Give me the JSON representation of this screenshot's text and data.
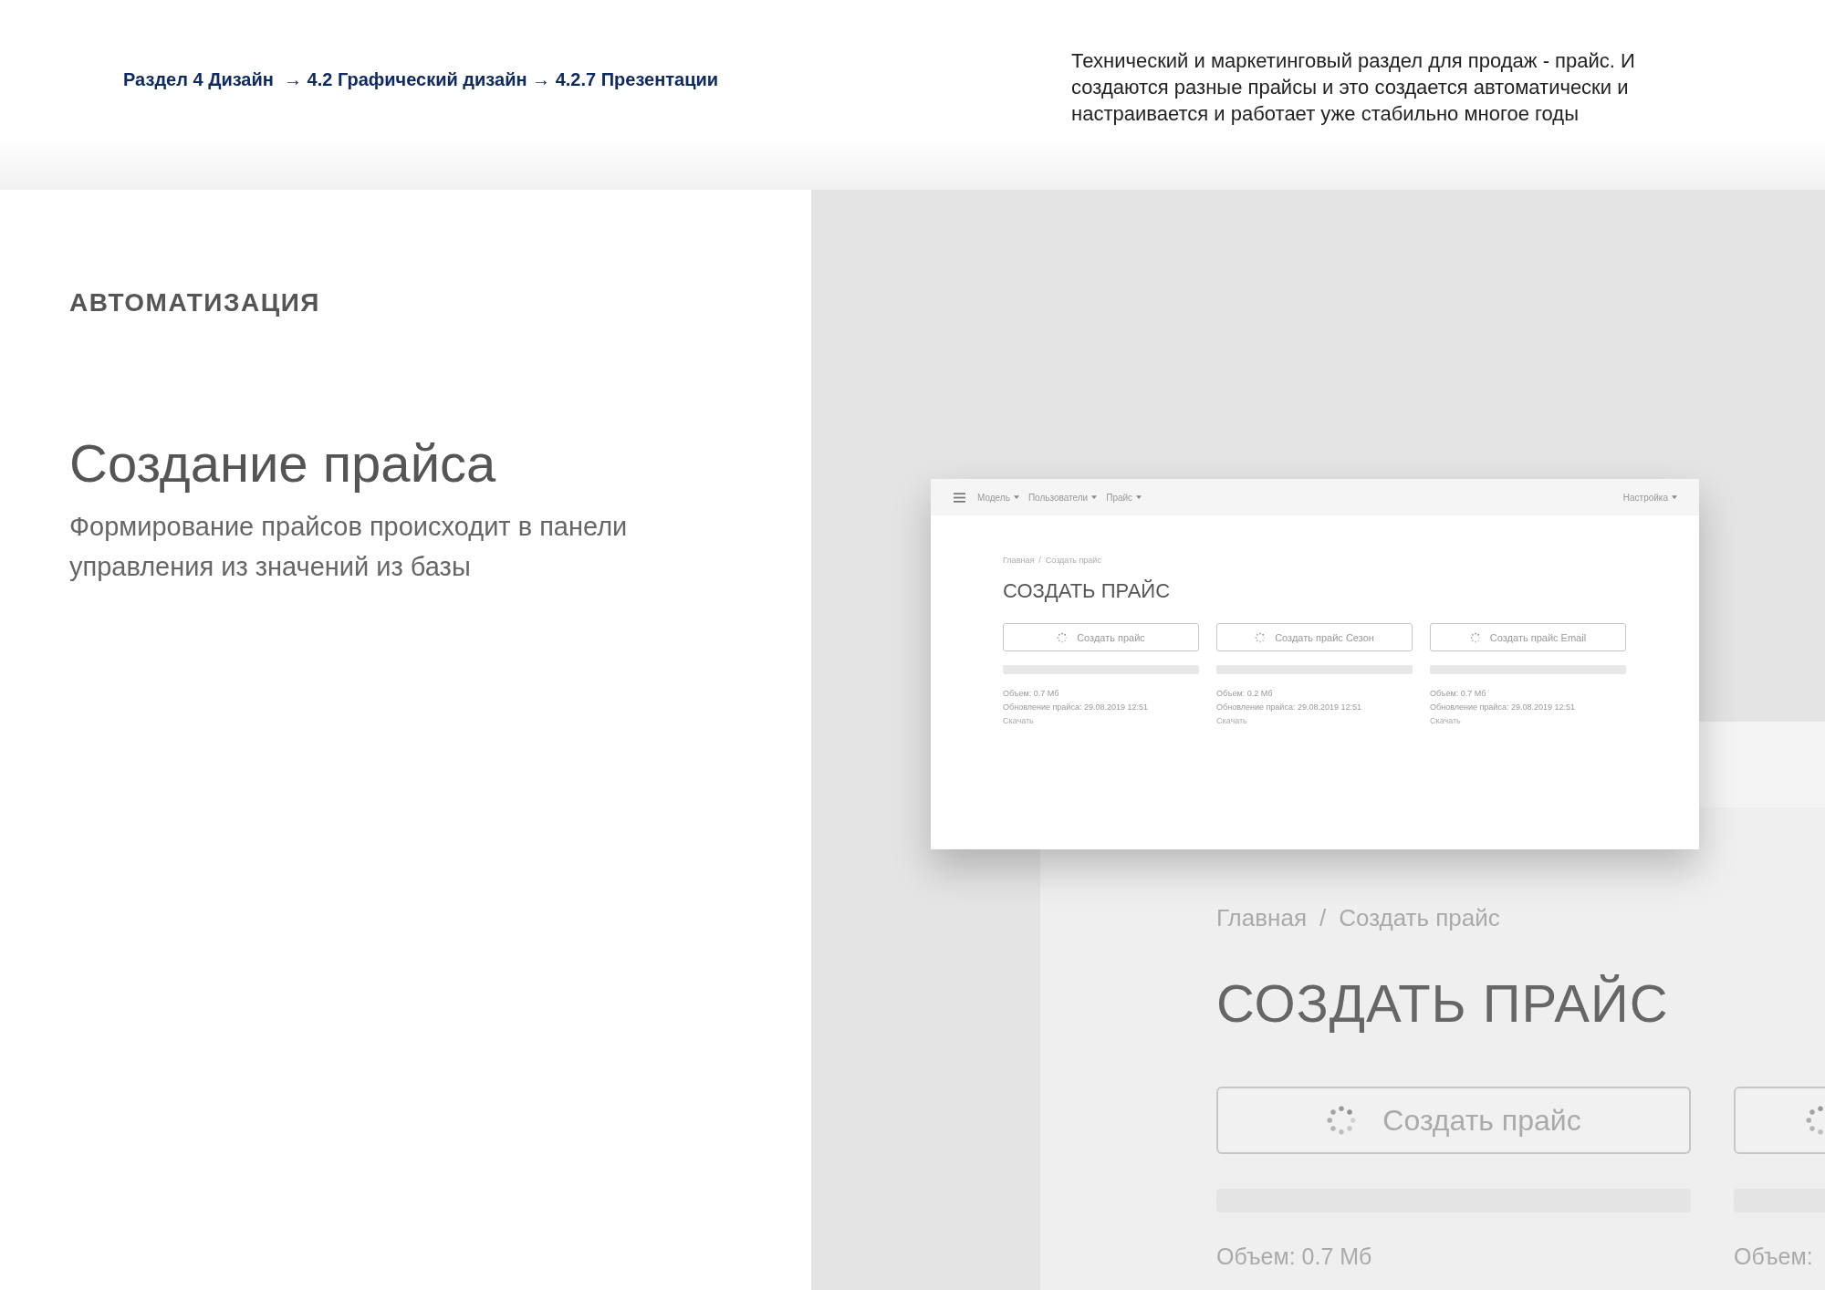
{
  "header": {
    "breadcrumb": "Раздел 4 Дизайн  → 4.2 Графический дизайн → 4.2.7 Презентации",
    "description": "Технический и маркетинговый раздел для продаж - прайс. И создаются разные прайсы и это создается автоматически и настраивается и работает уже стабильно многое годы"
  },
  "section": {
    "label": "АВТОМАТИЗАЦИЯ",
    "title": "Создание прайса",
    "text": "Формирование прайсов происходит в панели управления из значений из базы"
  },
  "preview_large": {
    "breadcrumb": [
      "Главная",
      "Создать прайс"
    ],
    "breadcrumb_separator": "/",
    "title": "СОЗДАТЬ ПРАЙС",
    "cards": [
      {
        "button": "Создать прайс",
        "lines": [
          "Объем: 0.7 Мб"
        ]
      },
      {
        "lines": [
          "Объем:"
        ]
      }
    ]
  },
  "preview_small": {
    "menu": [
      "Модель",
      "Пользователи",
      "Прайс"
    ],
    "settings": "Настройка",
    "breadcrumb": [
      "Главная",
      "Создать прайс"
    ],
    "breadcrumb_separator": "/",
    "title": "СОЗДАТЬ ПРАЙС",
    "cards": [
      {
        "button": "Создать прайс",
        "lines": [
          "Объем: 0.7 Мб",
          "Обновление прайса: 29.08.2019 12:51"
        ],
        "link": "Скачать"
      },
      {
        "button": "Создать прайс Сезон",
        "lines": [
          "Объем: 0.2 Мб",
          "Обновление прайса: 29.08.2019 12:51"
        ],
        "link": "Скачать"
      },
      {
        "button": "Создать прайс Email",
        "lines": [
          "Объем: 0.7 Мб",
          "Обновление прайса: 29.08.2019 12:51"
        ],
        "link": "Скачать"
      }
    ]
  }
}
